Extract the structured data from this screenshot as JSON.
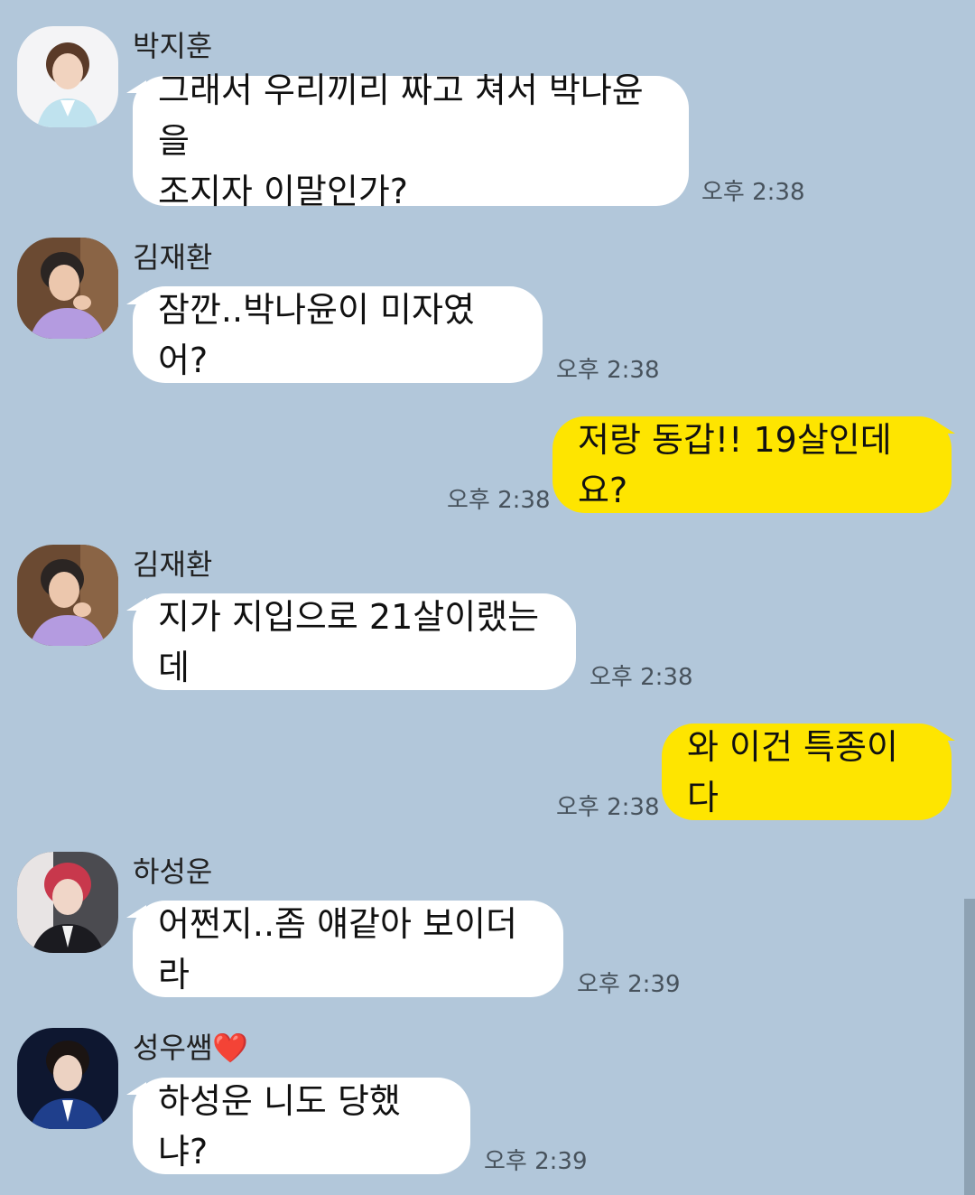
{
  "colors": {
    "background": "#b2c7da",
    "incoming_bubble": "#ffffff",
    "outgoing_bubble": "#fee500",
    "timestamp": "#47525c"
  },
  "messages": [
    {
      "sender": "박지훈",
      "text": "그래서 우리끼리 짜고 쳐서 박나윤을\n조지자 이말인가?",
      "time": "오후 2:38",
      "direction": "in"
    },
    {
      "sender": "김재환",
      "text": "잠깐..박나윤이 미자였어?",
      "time": "오후 2:38",
      "direction": "in"
    },
    {
      "text": "저랑 동갑!! 19살인데요?",
      "time": "오후 2:38",
      "direction": "out"
    },
    {
      "sender": "김재환",
      "text": "지가 지입으로 21살이랬는데",
      "time": "오후 2:38",
      "direction": "in"
    },
    {
      "text": "와 이건 특종이다",
      "time": "오후 2:38",
      "direction": "out"
    },
    {
      "sender": "하성운",
      "text": "어쩐지..좀 얘같아 보이더라",
      "time": "오후 2:39",
      "direction": "in"
    },
    {
      "sender": "성우쌤",
      "sender_badge": "❤️",
      "text": "하성운 니도 당했냐?",
      "time": "오후 2:39",
      "direction": "in"
    }
  ]
}
